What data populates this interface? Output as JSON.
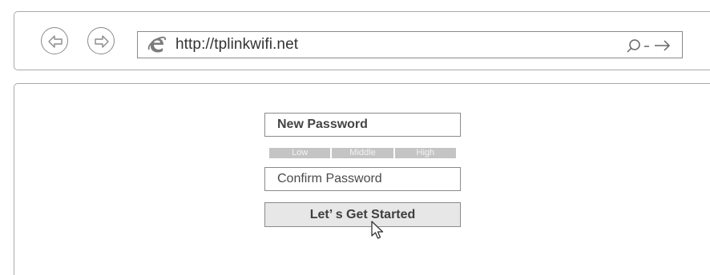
{
  "browser": {
    "url": "http://tplinkwifi.net",
    "search_go_glyph": "ρ - →"
  },
  "form": {
    "new_password_placeholder": "New Password",
    "confirm_password_placeholder": "Confirm Password",
    "strength_levels": [
      "Low",
      "Middle",
      "High"
    ],
    "submit_label": "Let’ s Get Started"
  },
  "icons": {
    "back": "arrow-left-icon",
    "forward": "arrow-right-icon",
    "browser_logo": "ie-logo-icon",
    "search": "search-icon",
    "dropdown": "dropdown-icon",
    "go": "go-arrow-icon",
    "cursor": "mouse-pointer-icon"
  },
  "colors": {
    "border": "#a9a9a9",
    "strength_bar": "#c4c4c4",
    "button_bg": "#e7e7e7"
  }
}
